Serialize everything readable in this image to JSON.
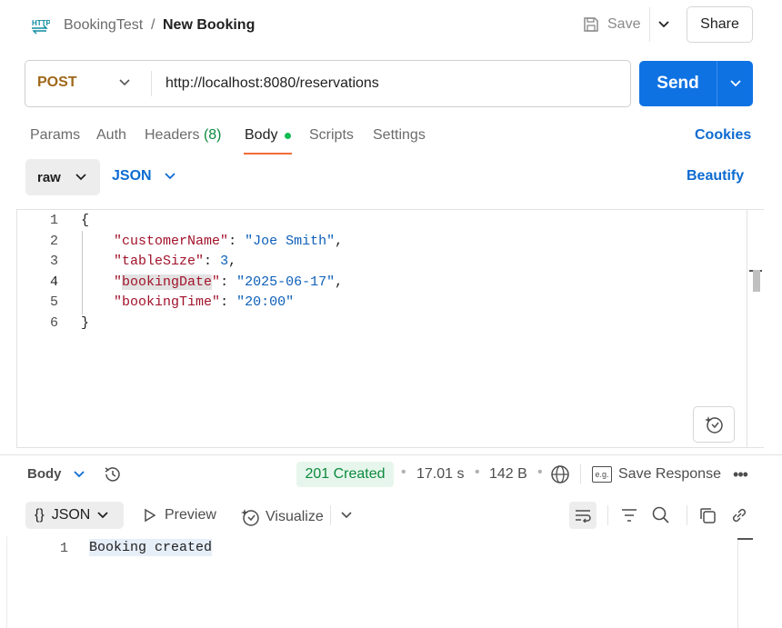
{
  "header": {
    "icon": "http-icon",
    "breadcrumb_parent": "BookingTest",
    "breadcrumb_sep": "/",
    "breadcrumb_current": "New Booking",
    "save_label": "Save",
    "share_label": "Share"
  },
  "request": {
    "method": "POST",
    "url": "http://localhost:8080/reservations",
    "send_label": "Send",
    "method_color": "#a0671a",
    "send_color": "#0e72e3"
  },
  "tabs": [
    {
      "label": "Params"
    },
    {
      "label": "Auth"
    },
    {
      "label": "Headers",
      "count": "(8)"
    },
    {
      "label": "Body",
      "active": true
    },
    {
      "label": "Scripts"
    },
    {
      "label": "Settings"
    }
  ],
  "cookies_label": "Cookies",
  "body_options": {
    "mode": "raw",
    "format": "JSON",
    "beautify_label": "Beautify"
  },
  "editor": {
    "line_numbers": [
      "1",
      "2",
      "3",
      "4",
      "5",
      "6"
    ],
    "open_brace": "{",
    "close_brace": "}",
    "fields": [
      {
        "key": "customerName",
        "value": "\"Joe Smith\"",
        "trail": ","
      },
      {
        "key": "tableSize",
        "value": "3",
        "trail": ","
      },
      {
        "key": "bookingDate",
        "value": "\"2025-06-17\"",
        "trail": ","
      },
      {
        "key": "bookingTime",
        "value": "\"20:00\"",
        "trail": ""
      }
    ]
  },
  "response": {
    "body_label": "Body",
    "status": "201 Created",
    "time": "17.01 s",
    "size": "142 B",
    "save_response_label": "Save Response",
    "eg_label": "e.g.",
    "format_label": "JSON",
    "format_braces": "{}",
    "preview_label": "Preview",
    "visualize_label": "Visualize",
    "line_number": "1",
    "text": "Booking created",
    "status_color": "#0c8a3e"
  }
}
